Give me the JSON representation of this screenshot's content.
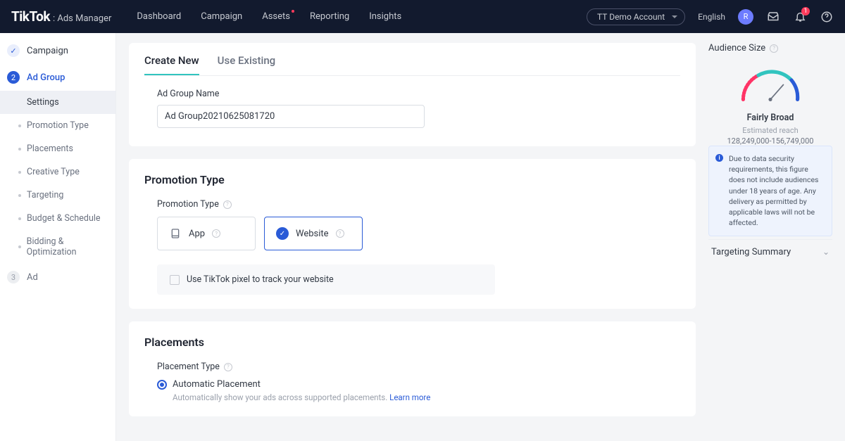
{
  "header": {
    "brand_main": "TikTok",
    "brand_sub": ": Ads Manager",
    "nav": [
      "Dashboard",
      "Campaign",
      "Assets",
      "Reporting",
      "Insights"
    ],
    "account": "TT Demo Account",
    "language": "English",
    "avatar_initial": "R",
    "notif_count": "1"
  },
  "sidebar": {
    "steps": [
      {
        "label": "Campaign",
        "badge": "✓",
        "state": "done"
      },
      {
        "label": "Ad Group",
        "badge": "2",
        "state": "active"
      },
      {
        "label": "Ad",
        "badge": "3",
        "state": "pending"
      }
    ],
    "subnav": [
      "Settings",
      "Promotion Type",
      "Placements",
      "Creative Type",
      "Targeting",
      "Budget & Schedule",
      "Bidding & Optimization"
    ]
  },
  "tabs": {
    "create": "Create New",
    "existing": "Use Existing"
  },
  "ad_group": {
    "name_label": "Ad Group Name",
    "name_value": "Ad Group20210625081720"
  },
  "promotion": {
    "title": "Promotion Type",
    "label": "Promotion Type",
    "options": {
      "app": "App",
      "website": "Website"
    },
    "pixel_text": "Use TikTok pixel to track your website"
  },
  "placements": {
    "title": "Placements",
    "type_label": "Placement Type",
    "auto_label": "Automatic Placement",
    "auto_desc": "Automatically show your ads across supported placements. ",
    "learn_more": "Learn more"
  },
  "audience": {
    "title": "Audience Size",
    "level": "Fairly Broad",
    "sub": "Estimated reach",
    "range": "128,249,000-156,749,000",
    "notice": "Due to data security requirements, this figure does not include audiences under 18 years of age. Any delivery as permitted by applicable laws will not be affected."
  },
  "targeting_summary": "Targeting Summary"
}
